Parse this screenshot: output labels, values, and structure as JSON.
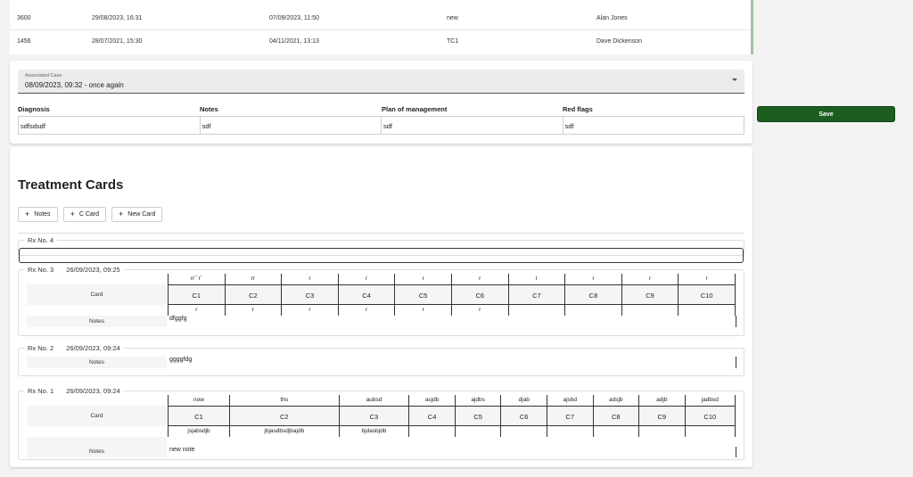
{
  "cases_table": {
    "rows": [
      {
        "id": "3600",
        "created": "29/08/2023, 16:31",
        "updated": "07/09/2023, 11:50",
        "name": "new",
        "owner": "Alan Jones"
      },
      {
        "id": "1456",
        "created": "28/07/2021, 15:30",
        "updated": "04/11/2021, 13:13",
        "name": "TC1",
        "owner": "Dave Dickenson"
      }
    ]
  },
  "associated_case": {
    "label": "Associated Case",
    "value": "08/09/2023, 09:32 - once again"
  },
  "diagnosis": {
    "headers": [
      "Diagnosis",
      "Notes",
      "Plan of management",
      "Red flags"
    ],
    "values": [
      "sdfsdsdf",
      "sdf",
      "sdf",
      "sdf"
    ]
  },
  "save_label": "Save",
  "treatment": {
    "title": "Treatment Cards",
    "buttons": [
      "Notes",
      "C Card",
      "New Card"
    ],
    "rx4": {
      "label": "Rx No. 4"
    },
    "rx3": {
      "label": "Rx No. 3",
      "date": "26/09/2023, 09:25",
      "card_label": "Card",
      "notes_label": "Notes",
      "top": [
        "rr`´r`",
        "rr",
        "r",
        "r",
        "r",
        "r",
        "r",
        "r",
        "r",
        "r"
      ],
      "cards": [
        "C1",
        "C2",
        "C3",
        "C4",
        "C5",
        "C6",
        "C7",
        "C8",
        "C9",
        "C10"
      ],
      "bottom": [
        "r",
        "r",
        "r",
        "r",
        "r",
        "r",
        "",
        "",
        "",
        ""
      ],
      "notes": "dfggfg"
    },
    "rx2": {
      "label": "Rx No. 2",
      "date": "26/09/2023, 09:24",
      "notes_label": "Notes",
      "notes": "ggggfdg"
    },
    "rx1": {
      "label": "Rx No. 1",
      "date": "26/09/2023, 09:24",
      "card_label": "Card",
      "notes_label": "Notes",
      "top": [
        "now",
        "ths",
        "aubsd",
        "asjdb",
        "ajdbs",
        "djab",
        "ajsbd",
        "adsjb",
        "adjb",
        "jadbsd"
      ],
      "cards": [
        "C1",
        "C2",
        "C3",
        "C4",
        "C5",
        "C6",
        "C7",
        "C8",
        "C9",
        "C10"
      ],
      "bottom": [
        "jsjabsdjb",
        "jbjasdbsdjbajdb",
        "bjdasbjdb",
        "",
        "",
        "",
        "",
        "",
        "",
        ""
      ],
      "notes": "new note"
    }
  }
}
